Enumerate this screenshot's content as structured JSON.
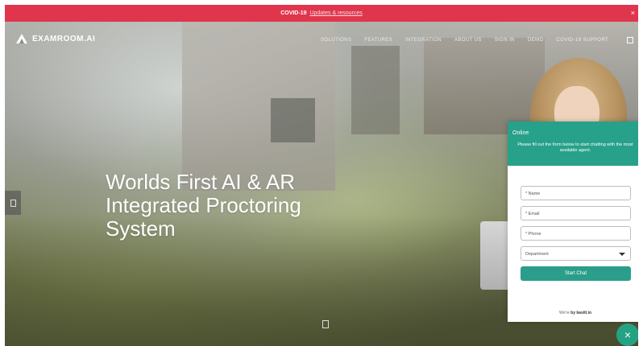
{
  "banner": {
    "bold": "COVID-19",
    "link": "Updates & resources",
    "close": "×"
  },
  "nav": {
    "logo": "EXAMROOM.AI",
    "items": [
      "SOLUTIONS",
      "FEATURES",
      "INTEGRATION",
      "ABOUT US",
      "SIGN IN",
      "DEMO",
      "COVID-19 SUPPORT"
    ]
  },
  "hero": {
    "title_lines": [
      "Worlds First AI & AR",
      "Integrated Proctoring",
      "System"
    ]
  },
  "chat": {
    "status": "Online",
    "message": "Please fill out the form below to start chatting with the most available agent.",
    "fields": {
      "name": "* Name",
      "email": "* Email",
      "phone": "* Phone"
    },
    "department": "Department",
    "start_button": "Start Chat",
    "powered_prefix": "We're ",
    "powered_brand": "by kasiit.io"
  },
  "fab": {
    "label": "×"
  },
  "colors": {
    "banner": "#e0364d",
    "accent": "#27a18a"
  }
}
